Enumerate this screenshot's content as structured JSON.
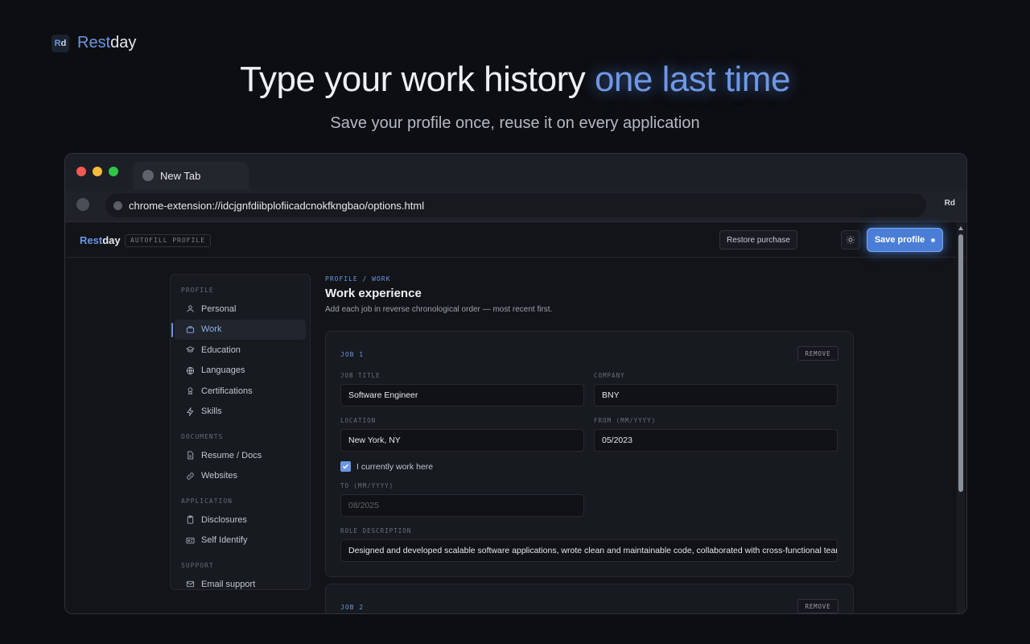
{
  "brand": {
    "badge_r": "R",
    "badge_d": "d",
    "rest": "Rest",
    "day": "day"
  },
  "hero": {
    "title_main": "Type your work history ",
    "title_highlight": "one last time",
    "subtitle": "Save your profile once, reuse it on every application"
  },
  "browser": {
    "tab_title": "New Tab",
    "url": "chrome-extension://idcjgnfdiibplofiicadcnokfkngbao/options.html",
    "extension_label": "Rd"
  },
  "app": {
    "brand_rest": "Rest",
    "brand_day": "day",
    "tag": "AUTOFILL PROFILE",
    "restore_label": "Restore purchase",
    "save_label": "Save profile"
  },
  "sidebar": {
    "sections": [
      {
        "title": "PROFILE",
        "items": [
          "Personal",
          "Work",
          "Education",
          "Languages",
          "Certifications",
          "Skills"
        ]
      },
      {
        "title": "DOCUMENTS",
        "items": [
          "Resume / Docs",
          "Websites"
        ]
      },
      {
        "title": "APPLICATION",
        "items": [
          "Disclosures",
          "Self Identify"
        ]
      },
      {
        "title": "SUPPORT",
        "items": [
          "Email support"
        ]
      }
    ],
    "active": "Work"
  },
  "main": {
    "breadcrumb": "PROFILE / WORK",
    "title": "Work experience",
    "description": "Add each job in reverse chronological order — most recent first."
  },
  "job1": {
    "header": "JOB 1",
    "remove_label": "REMOVE",
    "job_title_label": "JOB TITLE",
    "job_title": "Software Engineer",
    "company_label": "COMPANY",
    "company": "BNY",
    "location_label": "LOCATION",
    "location": "New York, NY",
    "from_label": "FROM (MM/YYYY)",
    "from": "05/2023",
    "current_label": "I currently work here",
    "current": true,
    "to_label": "TO (MM/YYYY)",
    "to": "08/2025",
    "role_label": "ROLE DESCRIPTION",
    "role": "Designed and developed scalable software applications, wrote clean and maintainable code, collaborated with cross-functional teams"
  },
  "job2": {
    "header": "JOB 2",
    "remove_label": "REMOVE"
  },
  "colors": {
    "accent": "#6b96e3",
    "save_button": "#4a7ed6",
    "background": "#0d0e12"
  }
}
